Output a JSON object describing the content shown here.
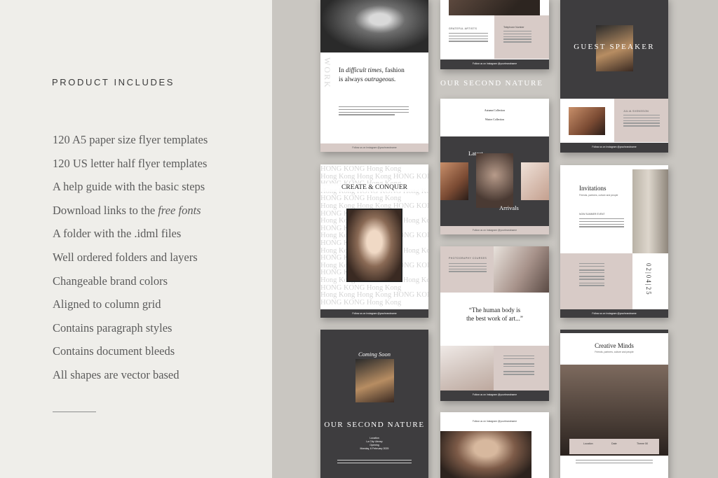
{
  "product_section": {
    "heading": "PRODUCT INCLUDES",
    "features": [
      "120 A5 paper size flyer templates",
      "120 US letter half flyer templates",
      "A help guide with the basic steps",
      "Download links to the",
      "A folder with the .idml files",
      "Well ordered folders and layers",
      "Changeable brand colors",
      "Aligned to column grid",
      "Contains paragraph styles",
      "Contains document bleeds",
      "All shapes are vector based"
    ],
    "feature_italic": "free fonts"
  },
  "colors": {
    "panel_bg": "#efeeea",
    "preview_bg": "#c9c6c1",
    "dark_accent": "#3e3d3f",
    "pink_accent": "#d8cbc7"
  },
  "flyers": {
    "footer_text": "Follow us on Instagram @yourbrandname",
    "quote_card": {
      "prefix": "In",
      "em1": "difficult times,",
      "mid": "fashion",
      "line2": "is always",
      "em2": "outrageous.",
      "vertical": "WORK"
    },
    "contact_card": {
      "left_label": "GRATEFUL ARTISTS",
      "right_label": "Telephone Number"
    },
    "guest_card": {
      "title": "GUEST SPEAKER",
      "name": "JULIA SVENSSON"
    },
    "hong_kong_card": {
      "title": "CREATE & CONQUER",
      "pattern": [
        "HONG KONG Hong Kong",
        "Hong Kong Hong Kong HONG KONG",
        "HONG KONG Hong Kong",
        "Hong Kong HONG KONG Hong Kong"
      ]
    },
    "latest_card": {
      "banner": "OUR SECOND NATURE",
      "latest": "Latest",
      "arrivals": "Arrivals",
      "collection1": "Autumn Collection",
      "collection2": "Winter Collection"
    },
    "invitations_card": {
      "title": "Invitations",
      "subtitle": "Friends, partners, culture and people",
      "date": "02|04|25",
      "label": "NOW SUMMER EVENT"
    },
    "photography_card": {
      "label": "PHOTOGRAPHY COURSES",
      "quote_line1": "“The human body is",
      "quote_line2": "the best work of art...”"
    },
    "coming_soon_card": {
      "title": "Coming Soon",
      "banner": "OUR SECOND NATURE",
      "location_label": "Location",
      "location": "La City Library",
      "opening_label": "Opening",
      "opening": "Monday, 6 February 2025"
    },
    "creative_card": {
      "title": "Creative Minds",
      "subtitle": "Friends, partners, culture and people",
      "cols": [
        "Location",
        "Date",
        "Theme 50"
      ]
    }
  }
}
